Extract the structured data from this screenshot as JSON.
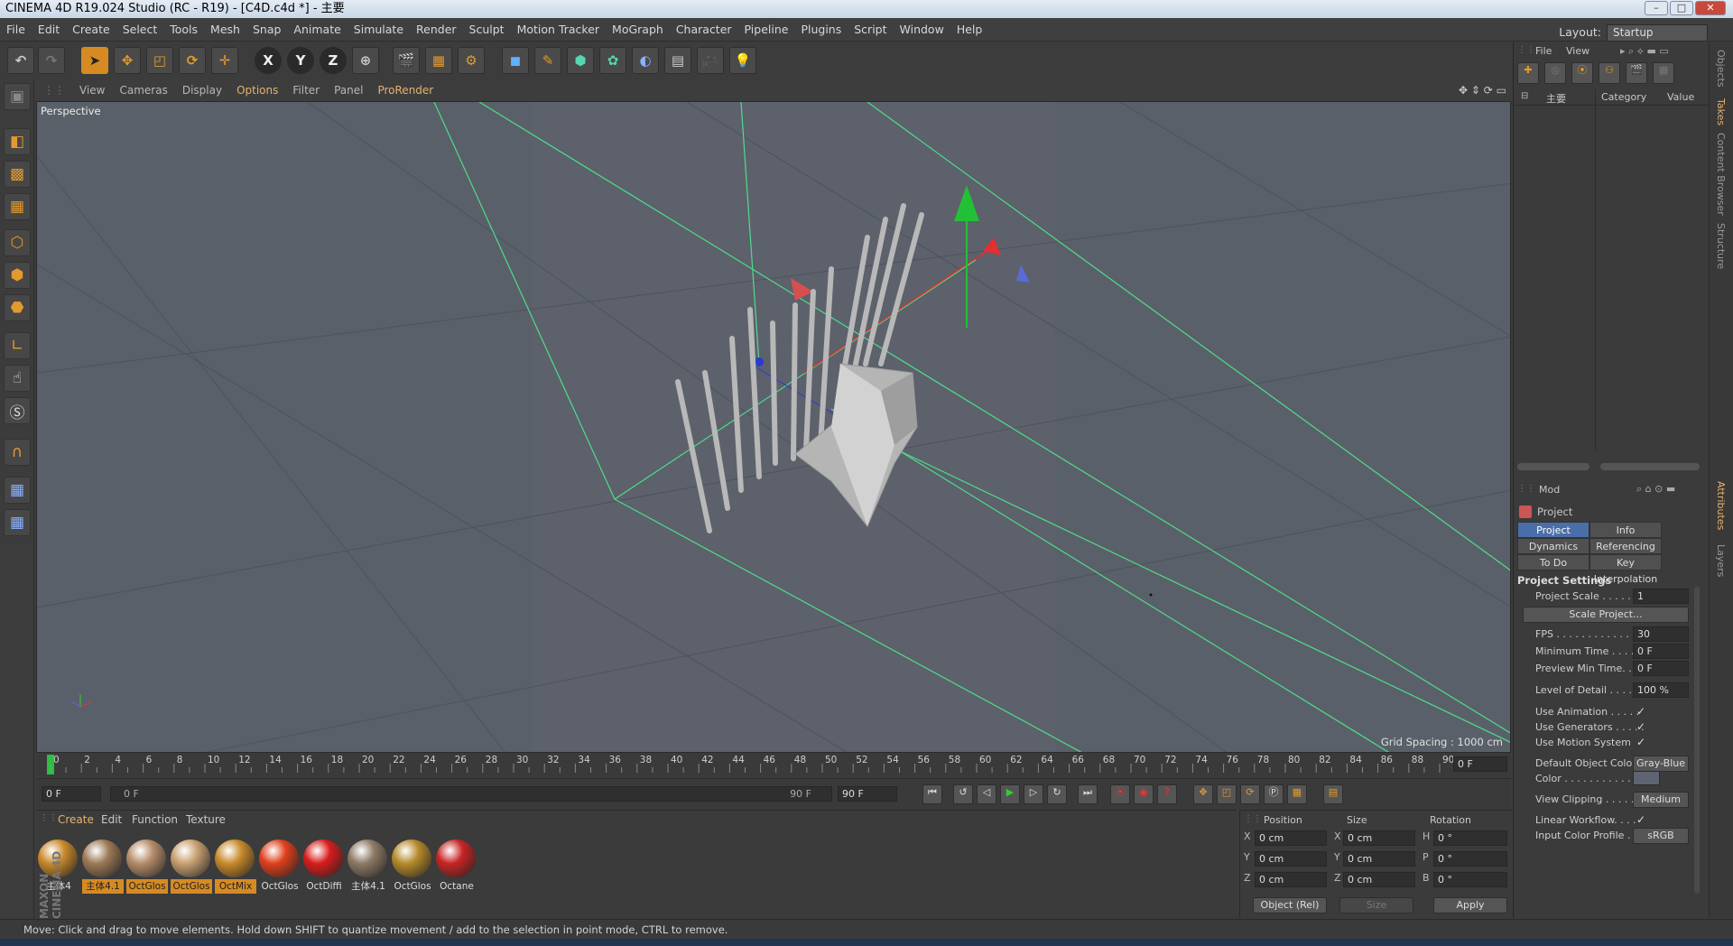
{
  "window": {
    "title": "CINEMA 4D R19.024 Studio (RC - R19) - [C4D.c4d *] - 主要",
    "min": "–",
    "max": "□",
    "close": "✕"
  },
  "menu": [
    "File",
    "Edit",
    "Create",
    "Select",
    "Tools",
    "Mesh",
    "Snap",
    "Animate",
    "Simulate",
    "Render",
    "Sculpt",
    "Motion Tracker",
    "MoGraph",
    "Character",
    "Pipeline",
    "Plugins",
    "Script",
    "Window",
    "Help"
  ],
  "layout": {
    "label": "Layout:",
    "value": "Startup"
  },
  "toolbar": {
    "x_label": "X",
    "y_label": "Y",
    "z_label": "Z"
  },
  "viewport": {
    "menu": [
      "View",
      "Cameras",
      "Display",
      "Options",
      "Filter",
      "Panel",
      "ProRender"
    ],
    "active_menu": "Options",
    "name": "Perspective",
    "grid_spacing": "Grid Spacing : 1000 cm"
  },
  "timeline": {
    "ticks": [
      "0",
      "2",
      "4",
      "6",
      "8",
      "10",
      "12",
      "14",
      "16",
      "18",
      "20",
      "22",
      "24",
      "26",
      "28",
      "30",
      "32",
      "34",
      "36",
      "38",
      "40",
      "42",
      "44",
      "46",
      "48",
      "50",
      "52",
      "54",
      "56",
      "58",
      "60",
      "62",
      "64",
      "66",
      "68",
      "70",
      "72",
      "74",
      "76",
      "78",
      "80",
      "82",
      "84",
      "86",
      "88",
      "90"
    ],
    "current_frame": "0 F",
    "start_frame": "0 F",
    "slider_start": "0 F",
    "slider_end": "90 F",
    "end_frame": "90 F"
  },
  "materials": {
    "menu": [
      "Create",
      "Edit",
      "Function",
      "Texture"
    ],
    "items": [
      {
        "label": "主体4",
        "color": "#c9892c",
        "selected": false
      },
      {
        "label": "主体4.1",
        "color": "#9c7a56",
        "selected": true
      },
      {
        "label": "OctGlos",
        "color": "#b58c6a",
        "selected": true
      },
      {
        "label": "OctGlos",
        "color": "#c8a070",
        "selected": true
      },
      {
        "label": "OctMix",
        "color": "#c88a2a",
        "selected": true
      },
      {
        "label": "OctGlos",
        "color": "#e0401c",
        "selected": false
      },
      {
        "label": "OctDiffi",
        "color": "#d81c1c",
        "selected": false
      },
      {
        "label": "主体4.1",
        "color": "#8c7a64",
        "selected": false
      },
      {
        "label": "OctGlos",
        "color": "#b58a2a",
        "selected": false
      },
      {
        "label": "Octane",
        "color": "#c82424",
        "selected": false
      }
    ]
  },
  "coordinates": {
    "headers": [
      "Position",
      "Size",
      "Rotation"
    ],
    "rows": [
      {
        "axis": "X",
        "pos": "0 cm",
        "saxis": "X",
        "size": "0 cm",
        "raxis": "H",
        "rot": "0 °"
      },
      {
        "axis": "Y",
        "pos": "0 cm",
        "saxis": "Y",
        "size": "0 cm",
        "raxis": "P",
        "rot": "0 °"
      },
      {
        "axis": "Z",
        "pos": "0 cm",
        "saxis": "Z",
        "size": "0 cm",
        "raxis": "B",
        "rot": "0 °"
      }
    ],
    "mode": "Object (Rel)",
    "size_mode": "Size",
    "apply": "Apply"
  },
  "object_manager": {
    "menu": [
      "File",
      "View"
    ],
    "root": "主要",
    "col_category": "Category",
    "col_value": "Value"
  },
  "attributes": {
    "mode": "Mod",
    "object": "Project",
    "tabs": [
      "Project Settings",
      "Info",
      "Dynamics",
      "Referencing",
      "To Do",
      "Key Interpolation"
    ],
    "section": "Project Settings",
    "props": {
      "project_scale": {
        "label": "Project Scale . . . . . . .",
        "value": "1"
      },
      "scale_project": "Scale Project...",
      "fps": {
        "label": "FPS . . . . . . . . . . . . . . .",
        "value": "30"
      },
      "min_time": {
        "label": "Minimum Time . . . . .",
        "value": "0 F"
      },
      "preview_min": {
        "label": "Preview Min Time. . .",
        "value": "0 F"
      },
      "lod": {
        "label": "Level of Detail . . . . . .",
        "value": "100 %"
      },
      "use_animation": {
        "label": "Use Animation . . . . .",
        "value": "✓"
      },
      "use_generators": {
        "label": "Use Generators . . . . .",
        "value": "✓"
      },
      "use_motion": {
        "label": "Use Motion System",
        "value": "✓"
      },
      "default_color": {
        "label": "Default Object Color",
        "value": "Gray-Blue"
      },
      "color": {
        "label": "Color . . . . . . . . . . . ."
      },
      "view_clipping": {
        "label": "View Clipping . . . . . .",
        "value": "Medium"
      },
      "linear_workflow": {
        "label": "Linear Workflow. . . .",
        "value": "✓"
      },
      "input_color": {
        "label": "Input Color Profile . .",
        "value": "sRGB"
      }
    }
  },
  "side_tabs": [
    "Objects",
    "Takes",
    "Content Browser",
    "Structure",
    "Attributes",
    "Layers"
  ],
  "status": "Move: Click and drag to move elements. Hold down SHIFT to quantize movement / add to the selection in point mode, CTRL to remove.",
  "brand": "MAXON CINEMA 4D",
  "colors": {
    "accent": "#d68a22",
    "highlight": "#4a6ea8",
    "viewport_bg": "#5a6069",
    "guide": "#4fdc8c"
  }
}
